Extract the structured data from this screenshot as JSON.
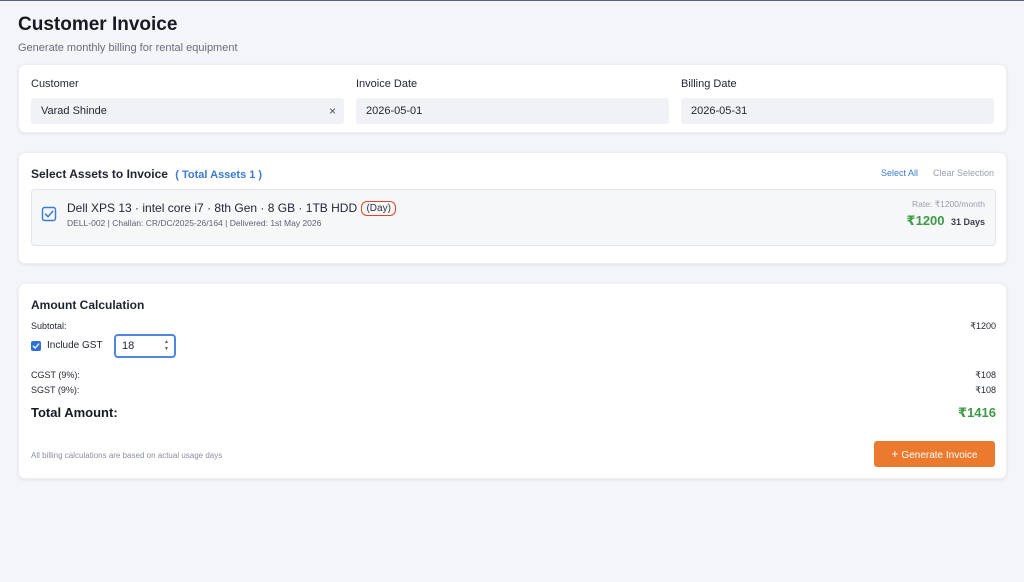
{
  "page": {
    "title": "Customer Invoice",
    "subtitle": "Generate monthly billing for rental equipment"
  },
  "customer_form": {
    "customer_label": "Customer",
    "customer_value": "Varad Shinde",
    "clear_symbol": "×",
    "invoice_date_label": "Invoice Date",
    "invoice_date_value": "2026-05-01",
    "billing_date_label": "Billing Date",
    "billing_date_value": "2026-05-31"
  },
  "assets": {
    "title": "Select Assets to Invoice",
    "total_label": "( Total Assets 1 )",
    "select_all": "Select All",
    "clear_selection": "Clear Selection",
    "items": [
      {
        "name": "Dell XPS 13 · intel core i7 · 8th Gen · 8 GB · 1TB HDD",
        "period_badge": "(Day)",
        "meta": "DELL-002 |  Challan: CR/DC/2025-26/164 | Delivered: 1st May 2026",
        "rate": "Rate: ₹1200/month",
        "amount": "₹1200",
        "days": "31 Days",
        "checked": true
      }
    ]
  },
  "amount": {
    "title": "Amount Calculation",
    "subtotal_label": "Subtotal:",
    "subtotal_value": "₹1200",
    "gst_label": "Include GST",
    "gst_checked": true,
    "gst_rate": "18",
    "cgst_label": "CGST (9%):",
    "cgst_value": "₹108",
    "sgst_label": "SGST (9%):",
    "sgst_value": "₹108",
    "total_label": "Total Amount:",
    "total_value": "₹1416",
    "footnote": "All billing calculations are based on actual usage days",
    "generate_button": "Generate Invoice"
  },
  "colors": {
    "accent_blue": "#3a7bd5",
    "success_green": "#3f9a45",
    "button_orange": "#ec7a2e",
    "badge_outline_red": "#e0452b"
  },
  "icons": {
    "checkbox": "checkbox-checked-icon",
    "plus": "plus-icon",
    "clear": "close-icon",
    "spinner": "spinner-arrows-icon"
  }
}
